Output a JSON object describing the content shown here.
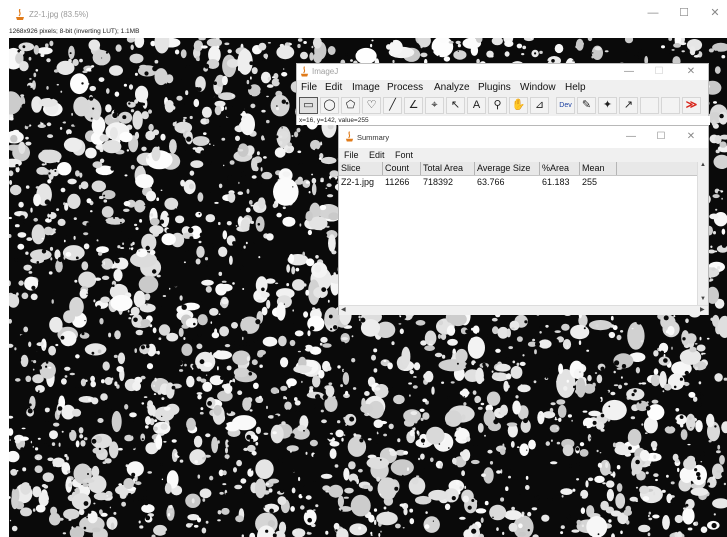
{
  "image_window": {
    "title": "Z2-1.jpg (83.5%)",
    "info": "1268x926 pixels; 8-bit (inverting LUT); 1.1MB",
    "controls": {
      "minimize": "—",
      "maximize": "☐",
      "close": "✕"
    }
  },
  "imagej": {
    "title": "ImageJ",
    "menu": [
      "File",
      "Edit",
      "Image",
      "Process",
      "Analyze",
      "Plugins",
      "Window",
      "Help"
    ],
    "tools": [
      {
        "icon": "rectangle-select-icon",
        "glyph": "▭"
      },
      {
        "icon": "oval-select-icon",
        "glyph": "◯"
      },
      {
        "icon": "polygon-select-icon",
        "glyph": "⬠"
      },
      {
        "icon": "freehand-select-icon",
        "glyph": "♡"
      },
      {
        "icon": "line-icon",
        "glyph": "╱"
      },
      {
        "icon": "angle-icon",
        "glyph": "∠"
      },
      {
        "icon": "point-icon",
        "glyph": "⌖"
      },
      {
        "icon": "wand-icon",
        "glyph": "↖"
      },
      {
        "icon": "text-icon",
        "glyph": "A"
      },
      {
        "icon": "magnifier-icon",
        "glyph": "⚲"
      },
      {
        "icon": "hand-icon",
        "glyph": "✋"
      },
      {
        "icon": "dropper-icon",
        "glyph": "⊿"
      },
      {
        "icon": "developer-menu-icon",
        "glyph": "Dev"
      },
      {
        "icon": "pencil-icon",
        "glyph": "✎"
      },
      {
        "icon": "brush-icon",
        "glyph": "✦"
      },
      {
        "icon": "flood-fill-icon",
        "glyph": "↗"
      },
      {
        "icon": "blank-slot-icon",
        "glyph": ""
      },
      {
        "icon": "blank-slot-icon",
        "glyph": ""
      },
      {
        "icon": "more-tools-icon",
        "glyph": "≫"
      }
    ],
    "status": "x=16, y=142, value=255",
    "controls": {
      "minimize": "—",
      "maximize": "☐",
      "close": "✕"
    }
  },
  "summary": {
    "title": "Summary",
    "menu": [
      "File",
      "Edit",
      "Font"
    ],
    "columns": [
      "Slice",
      "Count",
      "Total Area",
      "Average Size",
      "%Area",
      "Mean"
    ],
    "rows": [
      [
        "Z2-1.jpg",
        "11266",
        "718392",
        "63.766",
        "61.183",
        "255"
      ]
    ],
    "controls": {
      "minimize": "—",
      "maximize": "☐",
      "close": "✕"
    }
  },
  "colors": {
    "accent_red": "#d8261c",
    "java_orange": "#e07b1a"
  }
}
